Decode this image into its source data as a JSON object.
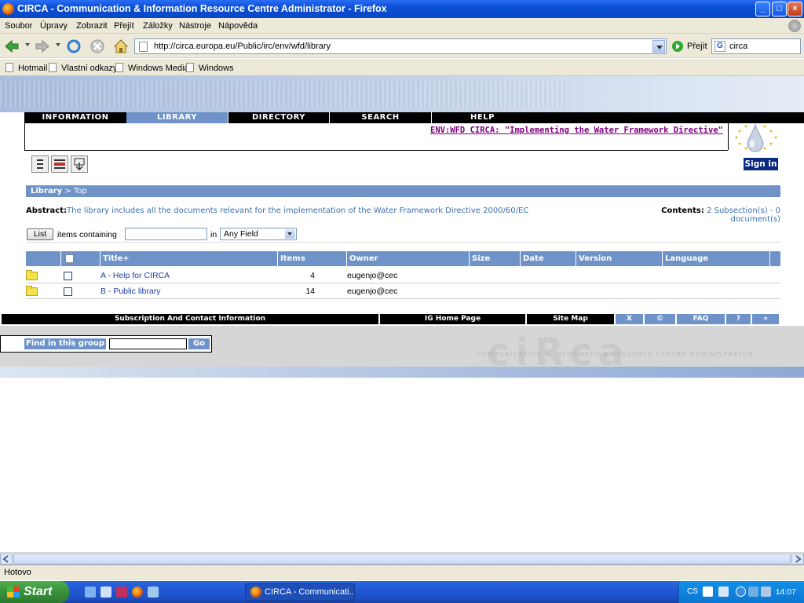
{
  "window": {
    "title": "CIRCA - Communication & Information Resource Centre Administrator - Firefox",
    "min": "_",
    "max": "□",
    "close": "×"
  },
  "menu": [
    "Soubor",
    "Úpravy",
    "Zobrazit",
    "Přejít",
    "Záložky",
    "Nástroje",
    "Nápověda"
  ],
  "toolbar": {
    "url": "http://circa.europa.eu/Public/irc/env/wfd/library",
    "go_label": "Přejít",
    "search_value": "circa",
    "search_engine_letter": "G"
  },
  "bookmarks": [
    "Hotmail",
    "Vlastní odkazy",
    "Windows Media",
    "Windows"
  ],
  "page": {
    "tabs": [
      {
        "label": "INFORMATION",
        "active": false
      },
      {
        "label": "LIBRARY",
        "active": true
      },
      {
        "label": "DIRECTORY",
        "active": false
      },
      {
        "label": "SEARCH",
        "active": false
      },
      {
        "label": "HELP",
        "active": false
      }
    ],
    "interest_group_title": "ENV:WFD CIRCA: \"Implementing the Water Framework Directive\"",
    "sign_in": "Sign in",
    "breadcrumb": {
      "root": "Library",
      "separator": ">",
      "current": "Top"
    },
    "abstract_label": "Abstract:",
    "abstract_text": "The library includes all the documents relevant for the implementation of the Water Framework Directive 2000/60/EC",
    "contents_label": "Contents:",
    "contents_text": "2 Subsection(s) - 0 document(s)",
    "filter": {
      "list_button": "List",
      "items_containing": "items containing",
      "in_label": "in",
      "field_value": "Any Field",
      "input_value": ""
    },
    "table": {
      "headers": [
        "Title+",
        "Items",
        "Owner",
        "Size",
        "Date",
        "Version",
        "Language"
      ],
      "rows": [
        {
          "title": "A - Help for CIRCA",
          "items": "4",
          "owner": "eugenjo@cec"
        },
        {
          "title": "B - Public library",
          "items": "14",
          "owner": "eugenjo@cec"
        }
      ]
    },
    "footer_links": {
      "subscription": "Subscription And Contact Information",
      "ig_home": "IG Home Page",
      "site_map": "Site Map",
      "x": "X",
      "copyright": "©",
      "faq": "FAQ",
      "help": "?",
      "more": "»"
    },
    "find_label": "Find in this group",
    "find_go": "Go",
    "watermark": "ciRca",
    "watermark_tagline": "COMMUNICATION & INFORMATION RESOURCE CENTRE ADMINISTRATOR"
  },
  "status": "Hotovo",
  "taskbar": {
    "start": "Start",
    "task_item": "CIRCA - Communicati...",
    "lang": "CS",
    "clock": "14:07"
  }
}
